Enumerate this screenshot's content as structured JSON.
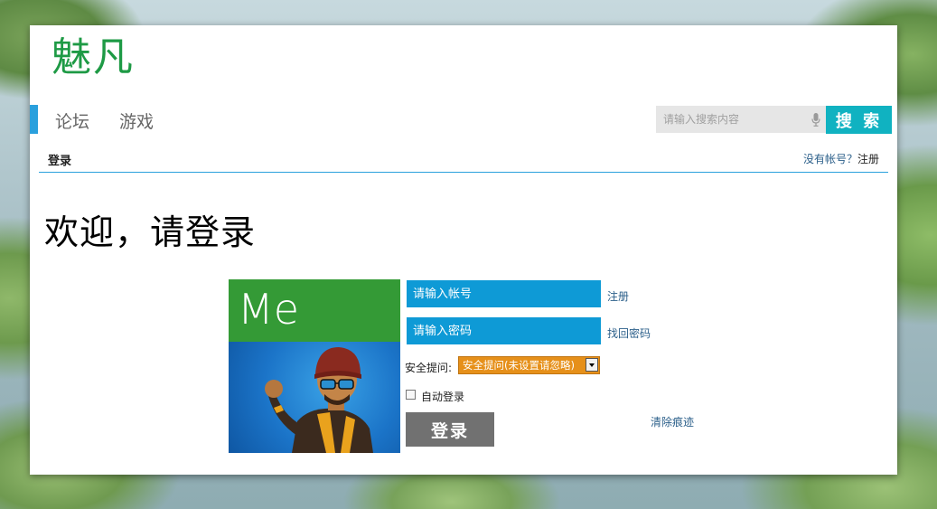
{
  "brand": {
    "logo_text": "魅凡",
    "logo_color": "#1e9a45"
  },
  "nav": {
    "items": [
      {
        "label": "论坛"
      },
      {
        "label": "游戏"
      }
    ],
    "search_placeholder": "请输入搜索内容",
    "search_button": "搜 索",
    "accent_color": "#2aa0dd",
    "search_button_color": "#10b2c1"
  },
  "breadcrumb": {
    "current": "登录",
    "no_account": "没有帐号？",
    "register_link": "注册"
  },
  "welcome": "欢迎，请登录",
  "tile": {
    "label": "Me",
    "color": "#349a36"
  },
  "form": {
    "username_placeholder": "请输入帐号",
    "username_side_link": "注册",
    "password_placeholder": "请输入密码",
    "password_side_link": "找回密码",
    "security_label": "安全提问:",
    "security_selected": "安全提问(未设置请忽略)",
    "auto_login_label": "自动登录",
    "auto_login_checked": false,
    "login_button": "登录",
    "clear_link": "清除痕迹",
    "field_color": "#0e9ad6"
  }
}
